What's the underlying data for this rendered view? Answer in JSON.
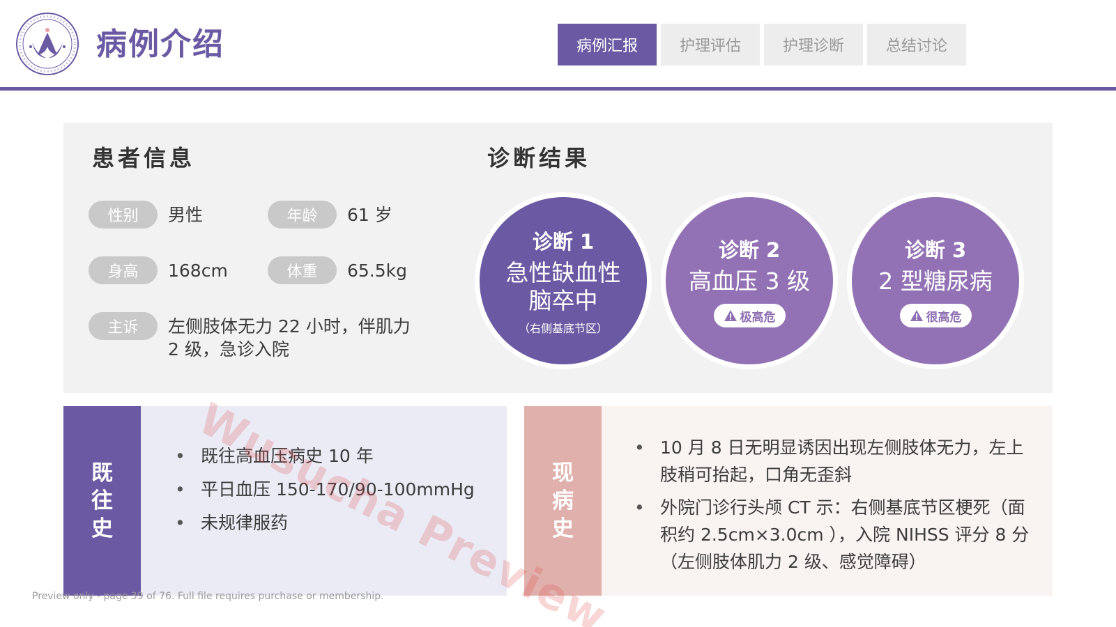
{
  "header": {
    "title": "病例介绍",
    "tabs": [
      {
        "label": "病例汇报",
        "active": true
      },
      {
        "label": "护理评估",
        "active": false
      },
      {
        "label": "护理诊断",
        "active": false
      },
      {
        "label": "总结讨论",
        "active": false
      }
    ]
  },
  "patient_info": {
    "title": "患者信息",
    "gender": {
      "label": "性别",
      "value": "男性"
    },
    "age": {
      "label": "年龄",
      "value": "61 岁"
    },
    "height": {
      "label": "身高",
      "value": "168cm"
    },
    "weight": {
      "label": "体重",
      "value": "65.5kg"
    },
    "complaint": {
      "label": "主诉",
      "value": "左侧肢体无力 22 小时，伴肌力 2 级，急诊入院"
    }
  },
  "diagnosis": {
    "title": "诊断结果",
    "items": [
      {
        "label": "诊断 1",
        "name_line1": "急性缺血性",
        "name_line2": "脑卒中",
        "note": "（右侧基底节区）"
      },
      {
        "label": "诊断 2",
        "name": "高血压 3 级",
        "risk": "极高危"
      },
      {
        "label": "诊断 3",
        "name": "2 型糖尿病",
        "risk": "很高危"
      }
    ]
  },
  "past_history": {
    "title_chars": [
      "既",
      "往",
      "史"
    ],
    "items": [
      "既往高血压病史 10 年",
      "平日血压 150-170/90-100mmHg",
      "未规律服药"
    ]
  },
  "present_history": {
    "title_chars": [
      "现",
      "病",
      "史"
    ],
    "items": [
      "10 月 8 日无明显诱因出现左侧肢体无力，左上肢稍可抬起，口角无歪斜",
      "外院门诊行头颅 CT 示：右侧基底节区梗死（面积约 2.5cm×3.0cm ），入院 NIHSS 评分 8 分（左侧肢体肌力 2 级、感觉障碍）"
    ]
  },
  "watermark": "Wusucha Preview",
  "footer": "Preview only - page 39 of 76. Full file requires purchase or membership.",
  "colors": {
    "primary": "#6b5aa3",
    "secondary": "#9272b4",
    "accent": "#e0b0ac",
    "panel": "#f2f2f2"
  },
  "icons": {
    "logo": "hospital-lotus-logo",
    "risk": "warning-triangle-icon"
  }
}
